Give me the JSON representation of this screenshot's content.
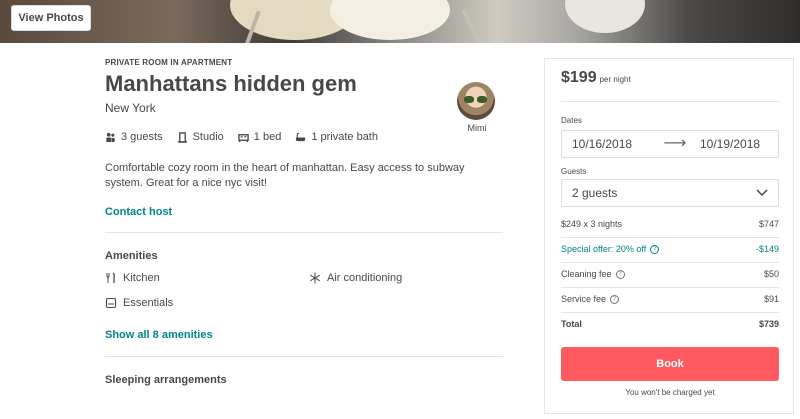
{
  "hero": {
    "view_photos_label": "View Photos"
  },
  "listing": {
    "type": "PRIVATE ROOM IN APARTMENT",
    "title": "Manhattans hidden gem",
    "city": "New York",
    "host_name": "Mimi",
    "facts": [
      {
        "icon": "guests-icon",
        "label": "3 guests"
      },
      {
        "icon": "studio-icon",
        "label": "Studio"
      },
      {
        "icon": "bed-icon",
        "label": "1 bed"
      },
      {
        "icon": "bath-icon",
        "label": "1 private bath"
      }
    ],
    "description": "Comfortable cozy room in the heart of manhattan. Easy access to subway system. Great for a nice nyc visit!",
    "contact_host": "Contact host"
  },
  "amenities": {
    "title": "Amenities",
    "items": [
      {
        "icon": "kitchen-icon",
        "label": "Kitchen"
      },
      {
        "icon": "snowflake-icon",
        "label": "Air conditioning"
      },
      {
        "icon": "essentials-icon",
        "label": "Essentials"
      }
    ],
    "show_all": "Show all 8 amenities"
  },
  "sleeping": {
    "title": "Sleeping arrangements"
  },
  "booking": {
    "price": "$199",
    "per_night": "per night",
    "dates_label": "Dates",
    "check_in": "10/16/2018",
    "check_out": "10/19/2018",
    "guests_label": "Guests",
    "guests_value": "2 guests",
    "lines": [
      {
        "label": "$249 x 3 nights",
        "amount": "$747"
      },
      {
        "label": "Special offer: 20% off",
        "amount": "-$149"
      },
      {
        "label": "Cleaning fee",
        "amount": "$50"
      },
      {
        "label": "Service fee",
        "amount": "$91"
      },
      {
        "label": "Total",
        "amount": "$739"
      }
    ],
    "book_label": "Book",
    "note": "You won't be charged yet"
  }
}
